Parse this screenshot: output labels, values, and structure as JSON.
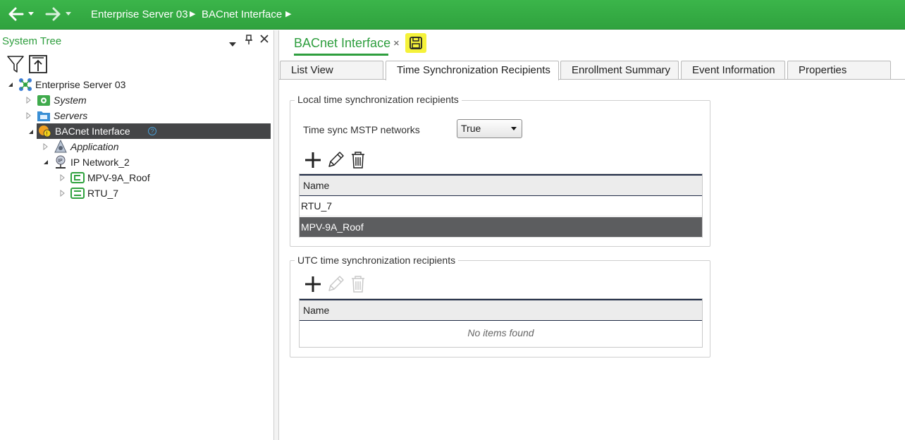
{
  "nav": {
    "breadcrumb": [
      "Enterprise Server 03",
      "BACnet Interface"
    ]
  },
  "system_tree": {
    "title": "System Tree",
    "items": [
      {
        "label": "Enterprise Server 03"
      },
      {
        "label": "System"
      },
      {
        "label": "Servers"
      },
      {
        "label": "BACnet Interface"
      },
      {
        "label": "Application"
      },
      {
        "label": "IP Network_2"
      },
      {
        "label": "MPV-9A_Roof"
      },
      {
        "label": "RTU_7"
      }
    ],
    "help_glyph": "?"
  },
  "document": {
    "tab_title": "BACnet Interface",
    "close_glyph": "×"
  },
  "tabs": [
    {
      "label": "List View"
    },
    {
      "label": "Time Synchronization Recipients"
    },
    {
      "label": "Enrollment Summary"
    },
    {
      "label": "Event Information"
    },
    {
      "label": "Properties"
    }
  ],
  "local_group": {
    "title": "Local time synchronization recipients",
    "mstp_label": "Time sync MSTP networks",
    "mstp_value": "True",
    "column_name": "Name",
    "rows": [
      "RTU_7",
      "MPV-9A_Roof"
    ]
  },
  "utc_group": {
    "title": "UTC time synchronization recipients",
    "column_name": "Name",
    "empty_text": "No items found"
  },
  "colors": {
    "accent_green": "#2e9e3e",
    "topbar_green": "#35ad45",
    "selection_dark": "#444547",
    "save_highlight": "#f5f23a"
  }
}
